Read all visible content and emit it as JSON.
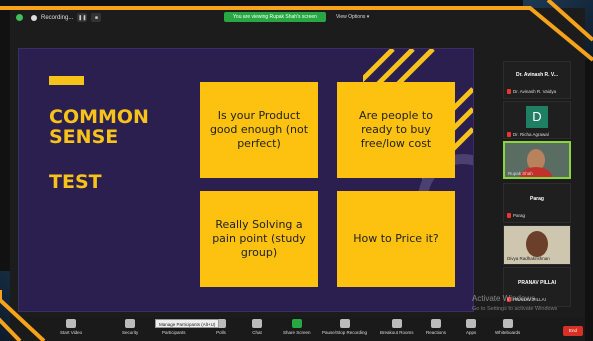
{
  "topbar": {
    "recording_label": "Recording...",
    "viewing_banner": "You are viewing Rupak Shah's screen",
    "view_options": "View Options"
  },
  "slide": {
    "title": "COMMON SENSE",
    "subtitle": "TEST",
    "boxes": [
      "Is your Product good enough (not perfect)",
      "Are people to ready to buy free/low cost",
      "Really Solving a pain point (study group)",
      "How to Price it?"
    ]
  },
  "participants": [
    {
      "title": "Dr. Avinash R. V...",
      "name": "Dr. Avinash R. Vaidya"
    },
    {
      "initial": "D",
      "name": "Dr. Richa Agrawal"
    },
    {
      "name": "Rupak Shah",
      "speaking": true
    },
    {
      "title": "Parag",
      "name": "Parag"
    },
    {
      "name": "Divya Radhakrishnan"
    },
    {
      "title": "PRANAV PILLAI",
      "name": "PRANAV PILLAI"
    }
  ],
  "watermark": {
    "title": "Activate Windows",
    "subtitle": "Go to Settings to activate Windows"
  },
  "toolbar": {
    "items": [
      "Start Video",
      "Security",
      "Participants",
      "Polls",
      "Chat",
      "Share Screen",
      "Pause/Stop Recording",
      "Breakout Rooms",
      "Reactions",
      "Apps",
      "Whiteboards"
    ],
    "tooltip": "Manage Participants (Alt+U)",
    "end_label": "End"
  },
  "colors": {
    "accent_yellow": "#fdc20f",
    "slide_bg": "#2a1f4e",
    "frame_orange": "#f6a21a",
    "zoom_green": "#27a843",
    "end_red": "#d93025"
  }
}
